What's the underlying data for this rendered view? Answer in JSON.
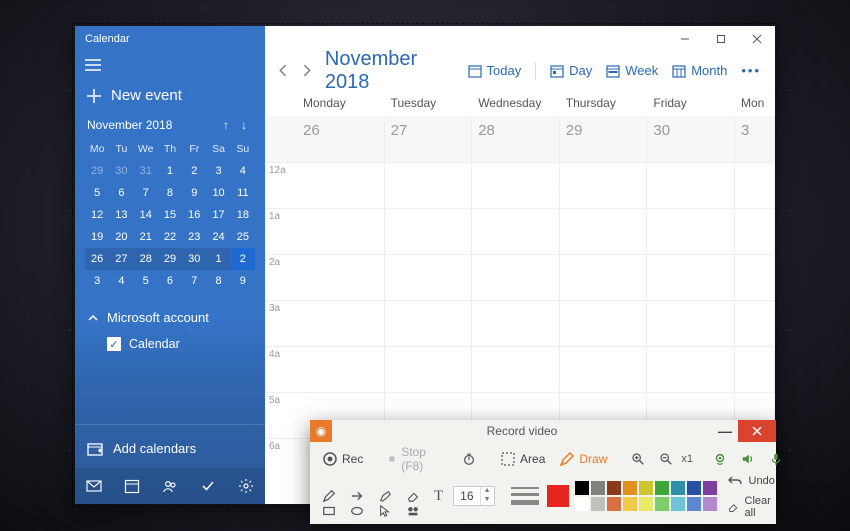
{
  "window": {
    "title": "Calendar"
  },
  "sidebar": {
    "new_event": "New event",
    "mini_month": "November 2018",
    "dow": [
      "Mo",
      "Tu",
      "We",
      "Th",
      "Fr",
      "Sa",
      "Su"
    ],
    "weeks": [
      [
        {
          "d": "29",
          "dim": true
        },
        {
          "d": "30",
          "dim": true
        },
        {
          "d": "31",
          "dim": true
        },
        {
          "d": "1"
        },
        {
          "d": "2"
        },
        {
          "d": "3"
        },
        {
          "d": "4"
        }
      ],
      [
        {
          "d": "5"
        },
        {
          "d": "6"
        },
        {
          "d": "7"
        },
        {
          "d": "8"
        },
        {
          "d": "9"
        },
        {
          "d": "10"
        },
        {
          "d": "11"
        }
      ],
      [
        {
          "d": "12"
        },
        {
          "d": "13"
        },
        {
          "d": "14"
        },
        {
          "d": "15"
        },
        {
          "d": "16"
        },
        {
          "d": "17"
        },
        {
          "d": "18"
        }
      ],
      [
        {
          "d": "19"
        },
        {
          "d": "20"
        },
        {
          "d": "21"
        },
        {
          "d": "22"
        },
        {
          "d": "23"
        },
        {
          "d": "24"
        },
        {
          "d": "25"
        }
      ],
      [
        {
          "d": "26",
          "wk": true
        },
        {
          "d": "27",
          "wk": true
        },
        {
          "d": "28",
          "wk": true
        },
        {
          "d": "29",
          "wk": true
        },
        {
          "d": "30",
          "wk": true
        },
        {
          "d": "1",
          "wk": true
        },
        {
          "d": "2",
          "hl": true,
          "wk": true
        }
      ],
      [
        {
          "d": "3"
        },
        {
          "d": "4"
        },
        {
          "d": "5"
        },
        {
          "d": "6"
        },
        {
          "d": "7"
        },
        {
          "d": "8"
        },
        {
          "d": "9"
        }
      ]
    ],
    "account_label": "Microsoft account",
    "calendar_checkbox": "Calendar",
    "add_calendars": "Add calendars"
  },
  "main": {
    "month_label": "November 2018",
    "today": "Today",
    "day": "Day",
    "week": "Week",
    "month": "Month",
    "dow": [
      "Monday",
      "Tuesday",
      "Wednesday",
      "Thursday",
      "Friday",
      "Mon"
    ],
    "dates": [
      "26",
      "27",
      "28",
      "29",
      "30",
      "3"
    ],
    "hours": [
      "12a",
      "1a",
      "2a",
      "3a",
      "4a",
      "5a",
      "6a"
    ]
  },
  "recorder": {
    "title": "Record video",
    "rec": "Rec",
    "stop": "Stop (F8)",
    "area": "Area",
    "draw": "Draw",
    "zoom": "x1",
    "font_size": "16",
    "undo": "Undo",
    "clear": "Clear all",
    "big_swatch": "#e52420",
    "palette": [
      "#000000",
      "#808080",
      "#8a3b17",
      "#e38f1e",
      "#c9c62f",
      "#3aa737",
      "#2f8fae",
      "#2952a3",
      "#7a3fa0",
      "#ffffff",
      "#c0c0c0",
      "#d96f3e",
      "#f2c84b",
      "#e9e96a",
      "#7ccf66",
      "#6fc3d6",
      "#5e86d1",
      "#b28ad0"
    ]
  }
}
